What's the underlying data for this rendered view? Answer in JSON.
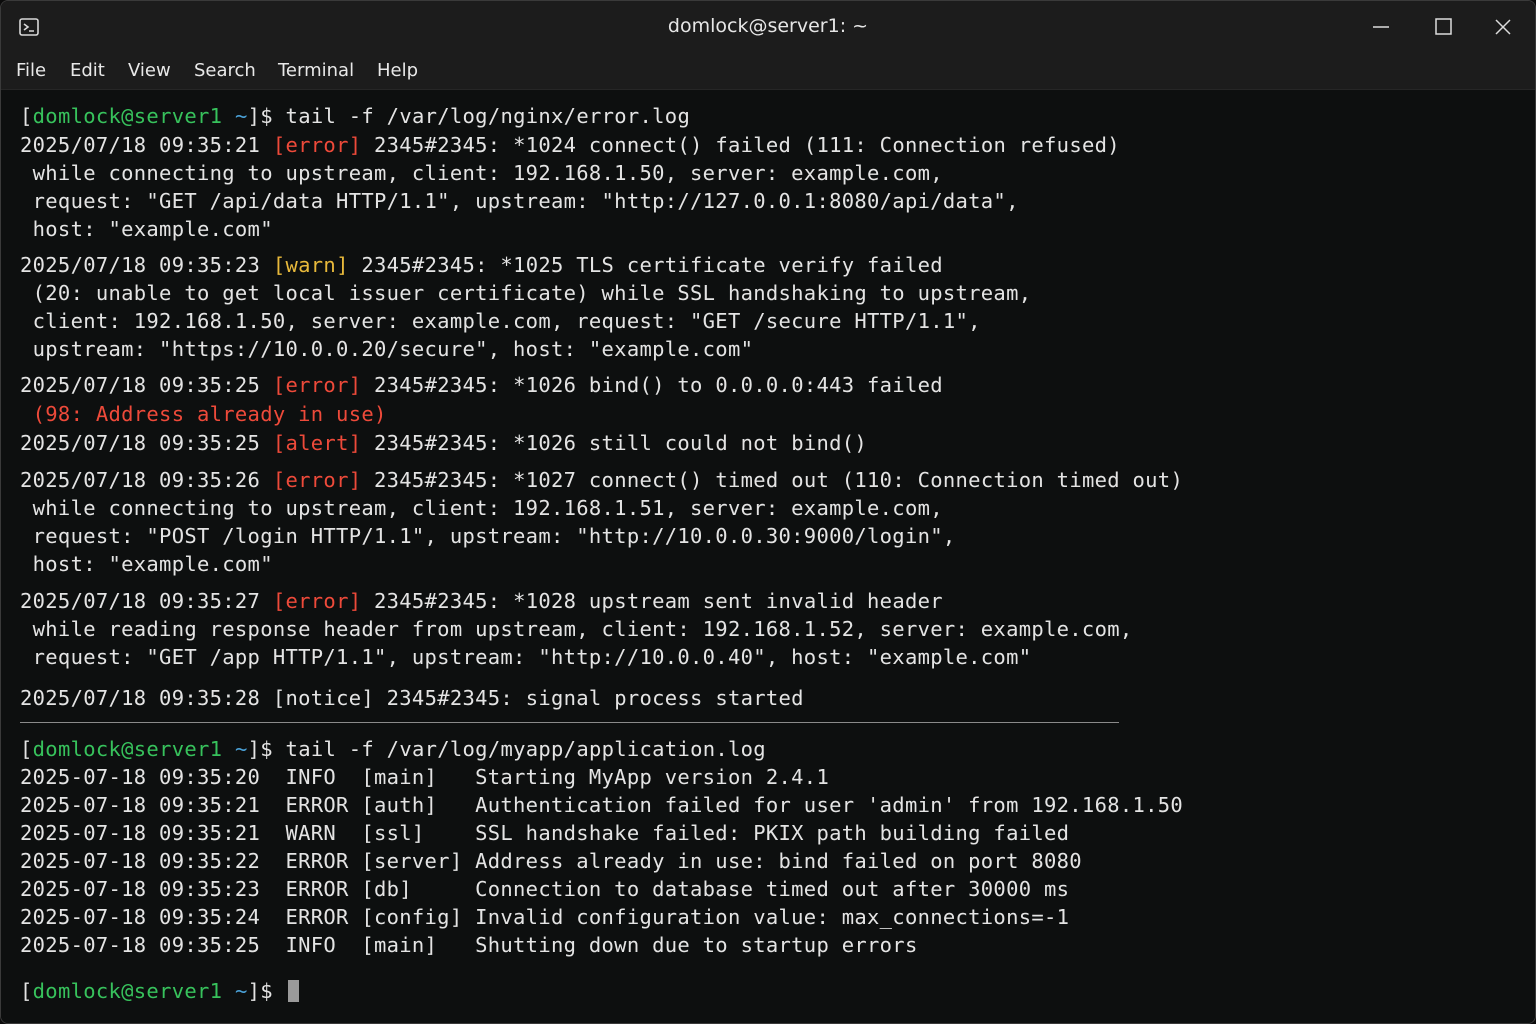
{
  "window": {
    "title": "domlock@server1: ~"
  },
  "menu": [
    "File",
    "Edit",
    "View",
    "Search",
    "Terminal",
    "Help"
  ],
  "prompt": {
    "user_host": "domlock@server1",
    "dir": "~"
  },
  "nginx": {
    "command": "tail -f /var/log/nginx/error.log",
    "entries": [
      {
        "time": "2025/07/18 09:35:21",
        "level": "[error]",
        "head": " 2345#2345: *1024 connect() failed (111: Connection refused)",
        "cont": [
          " while connecting to upstream, client: 192.168.1.50, server: example.com,",
          " request: \"GET /api/data HTTP/1.1\", upstream: \"http://127.0.0.1:8080/api/data\",",
          " host: \"example.com\""
        ]
      },
      {
        "time": "2025/07/18 09:35:23",
        "level": "[warn]",
        "head": " 2345#2345: *1025 TLS certificate verify failed",
        "cont": [
          " (20: unable to get local issuer certificate) while SSL handshaking to upstream,",
          " client: 192.168.1.50, server: example.com, request: \"GET /secure HTTP/1.1\",",
          " upstream: \"https://10.0.0.20/secure\", host: \"example.com\""
        ]
      },
      {
        "time": "2025/07/18 09:35:25",
        "level": "[error]",
        "head": " 2345#2345: *1026 bind() to 0.0.0.0:443 failed",
        "cont_red": " (98: Address already in use)"
      },
      {
        "time": "2025/07/18 09:35:25",
        "level": "[alert]",
        "head": " 2345#2345: *1026 still could not bind()"
      },
      {
        "time": "2025/07/18 09:35:26",
        "level": "[error]",
        "head": " 2345#2345: *1027 connect() timed out (110: Connection timed out)",
        "cont": [
          " while connecting to upstream, client: 192.168.1.51, server: example.com,",
          " request: \"POST /login HTTP/1.1\", upstream: \"http://10.0.0.30:9000/login\",",
          " host: \"example.com\""
        ]
      },
      {
        "time": "2025/07/18 09:35:27",
        "level": "[error]",
        "head": " 2345#2345: *1028 upstream sent invalid header",
        "cont": [
          " while reading response header from upstream, client: 192.168.1.52, server: example.com,",
          " request: \"GET /app HTTP/1.1\", upstream: \"http://10.0.0.40\", host: \"example.com\""
        ]
      },
      {
        "time": "2025/07/18 09:35:28",
        "level": "[notice]",
        "head": " 2345#2345: signal process started"
      }
    ]
  },
  "app": {
    "command": "tail -f /var/log/myapp/application.log",
    "lines": [
      "2025-07-18 09:35:20  INFO  [main]   Starting MyApp version 2.4.1",
      "2025-07-18 09:35:21  ERROR [auth]   Authentication failed for user 'admin' from 192.168.1.50",
      "2025-07-18 09:35:21  WARN  [ssl]    SSL handshake failed: PKIX path building failed",
      "2025-07-18 09:35:22  ERROR [server] Address already in use: bind failed on port 8080",
      "2025-07-18 09:35:23  ERROR [db]     Connection to database timed out after 30000 ms",
      "2025-07-18 09:35:24  ERROR [config] Invalid configuration value: max_connections=-1",
      "2025-07-18 09:35:25  INFO  [main]   Shutting down due to startup errors"
    ]
  },
  "colors": {
    "prompt": "#37c25c",
    "error": "#ee4a3a",
    "warn": "#e8b93b",
    "text": "#e4e4e4",
    "background": "#0d0f0f"
  }
}
